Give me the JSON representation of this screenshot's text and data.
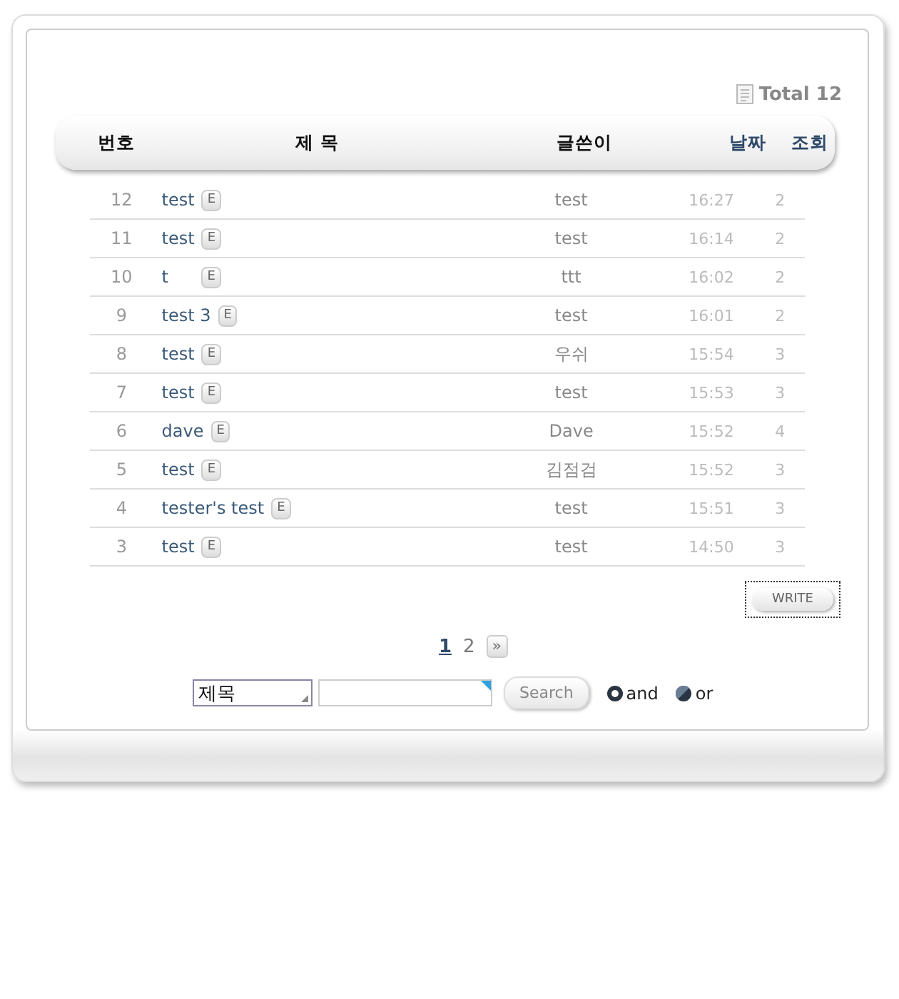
{
  "total": "Total 12",
  "columns": [
    {
      "label": "번호",
      "link": false
    },
    {
      "label": "제 목",
      "link": false
    },
    {
      "label": "글쓴이",
      "link": false
    },
    {
      "label": "날짜",
      "link": true
    },
    {
      "label": "조회",
      "link": true
    }
  ],
  "rows": [
    {
      "no": "12",
      "title": "test",
      "badge": "E",
      "author": "test",
      "time": "16:27",
      "views": "2"
    },
    {
      "no": "11",
      "title": "test",
      "badge": "E",
      "author": "test",
      "time": "16:14",
      "views": "2"
    },
    {
      "no": "10",
      "title": "t",
      "badge": "E",
      "author": "ttt",
      "time": "16:02",
      "views": "2"
    },
    {
      "no": "9",
      "title": "test 3",
      "badge": "E",
      "author": "test",
      "time": "16:01",
      "views": "2"
    },
    {
      "no": "8",
      "title": "test",
      "badge": "E",
      "author": "우쉬",
      "time": "15:54",
      "views": "3"
    },
    {
      "no": "7",
      "title": "test",
      "badge": "E",
      "author": "test",
      "time": "15:53",
      "views": "3"
    },
    {
      "no": "6",
      "title": "dave",
      "badge": "E",
      "author": "Dave",
      "time": "15:52",
      "views": "4"
    },
    {
      "no": "5",
      "title": "test",
      "badge": "E",
      "author": "김점검",
      "time": "15:52",
      "views": "3"
    },
    {
      "no": "4",
      "title": "tester's test",
      "badge": "E",
      "author": "test",
      "time": "15:51",
      "views": "3"
    },
    {
      "no": "3",
      "title": "test",
      "badge": "E",
      "author": "test",
      "time": "14:50",
      "views": "3"
    }
  ],
  "write_button": "WRITE",
  "pages": [
    {
      "label": "1",
      "selected": true
    },
    {
      "label": "2",
      "selected": false
    }
  ],
  "next_page": "»",
  "search": {
    "field_select": "제목",
    "button": "Search",
    "options": [
      {
        "label": "and",
        "selected": true
      },
      {
        "label": "or",
        "selected": false
      }
    ]
  }
}
